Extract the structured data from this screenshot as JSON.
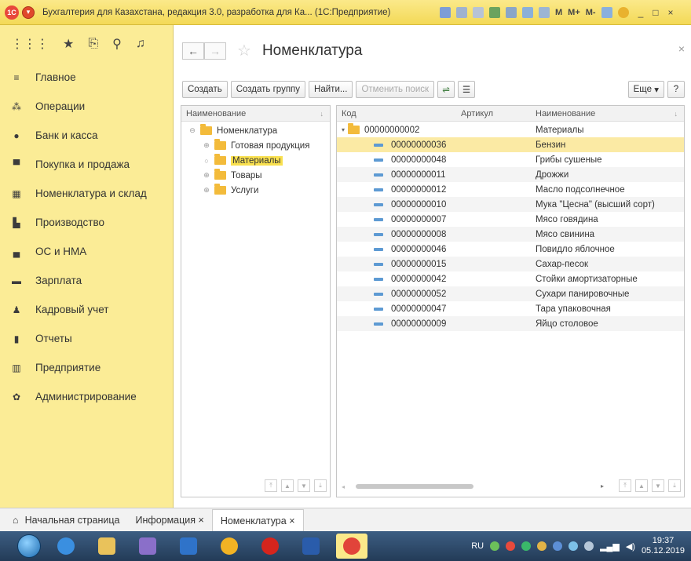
{
  "window": {
    "title": "Бухгалтерия для Казахстана, редакция 3.0, разработка для Ка... (1С:Предприятие)",
    "toolbar_text": [
      "M",
      "M+",
      "M-"
    ],
    "controls": [
      "_",
      "□",
      "×"
    ]
  },
  "sidebar": {
    "items": [
      {
        "label": "Главное",
        "icon": "menu-lines-icon"
      },
      {
        "label": "Операции",
        "icon": "operations-icon"
      },
      {
        "label": "Банк и касса",
        "icon": "money-icon"
      },
      {
        "label": "Покупка и продажа",
        "icon": "cart-icon"
      },
      {
        "label": "Номенклатура и склад",
        "icon": "warehouse-icon"
      },
      {
        "label": "Производство",
        "icon": "factory-icon"
      },
      {
        "label": "ОС и НМА",
        "icon": "truck-icon"
      },
      {
        "label": "Зарплата",
        "icon": "wallet-icon"
      },
      {
        "label": "Кадровый учет",
        "icon": "people-icon"
      },
      {
        "label": "Отчеты",
        "icon": "bar-chart-icon"
      },
      {
        "label": "Предприятие",
        "icon": "building-icon"
      },
      {
        "label": "Администрирование",
        "icon": "gear-icon"
      }
    ]
  },
  "form": {
    "title": "Номенклатура",
    "buttons": {
      "create": "Создать",
      "create_group": "Создать группу",
      "find": "Найти...",
      "cancel_search": "Отменить поиск",
      "more": "Еще",
      "help": "?"
    }
  },
  "tree": {
    "header": "Наименование",
    "rows": [
      {
        "label": "Номенклатура",
        "level": 0,
        "expander": "⊖"
      },
      {
        "label": "Готовая продукция",
        "level": 1,
        "expander": "⊕"
      },
      {
        "label": "Материалы",
        "level": 1,
        "expander": "○",
        "selected": true
      },
      {
        "label": "Товары",
        "level": 1,
        "expander": "⊕"
      },
      {
        "label": "Услуги",
        "level": 1,
        "expander": "⊕"
      }
    ]
  },
  "list": {
    "headers": {
      "code": "Код",
      "article": "Артикул",
      "name": "Наименование"
    },
    "group_row": {
      "code": "00000000002",
      "name": "Материалы"
    },
    "rows": [
      {
        "code": "00000000036",
        "name": "Бензин",
        "selected": true
      },
      {
        "code": "00000000048",
        "name": "Грибы сушеные"
      },
      {
        "code": "00000000011",
        "name": "Дрожжи"
      },
      {
        "code": "00000000012",
        "name": "Масло подсолнечное"
      },
      {
        "code": "00000000010",
        "name": "Мука \"Цесна\" (высший сорт)"
      },
      {
        "code": "00000000007",
        "name": "Мясо говядина"
      },
      {
        "code": "00000000008",
        "name": "Мясо свинина"
      },
      {
        "code": "00000000046",
        "name": "Повидло яблочное"
      },
      {
        "code": "00000000015",
        "name": "Сахар-песок"
      },
      {
        "code": "00000000042",
        "name": "Стойки амортизаторные"
      },
      {
        "code": "00000000052",
        "name": "Сухари панировочные"
      },
      {
        "code": "00000000047",
        "name": "Тара упаковочная"
      },
      {
        "code": "00000000009",
        "name": "Яйцо столовое"
      }
    ]
  },
  "tabs": [
    {
      "label": "Начальная страница",
      "icon": "home-icon"
    },
    {
      "label": "Информация ×"
    },
    {
      "label": "Номенклатура ×",
      "active": true
    }
  ],
  "taskbar": {
    "lang": "RU",
    "time": "19:37",
    "date": "05.12.2019"
  },
  "colors": {
    "sidebar_bg": "#fbec96",
    "selection": "#fbeaa4",
    "tree_selection": "#f9e04f",
    "folder": "#f3bb3b"
  }
}
